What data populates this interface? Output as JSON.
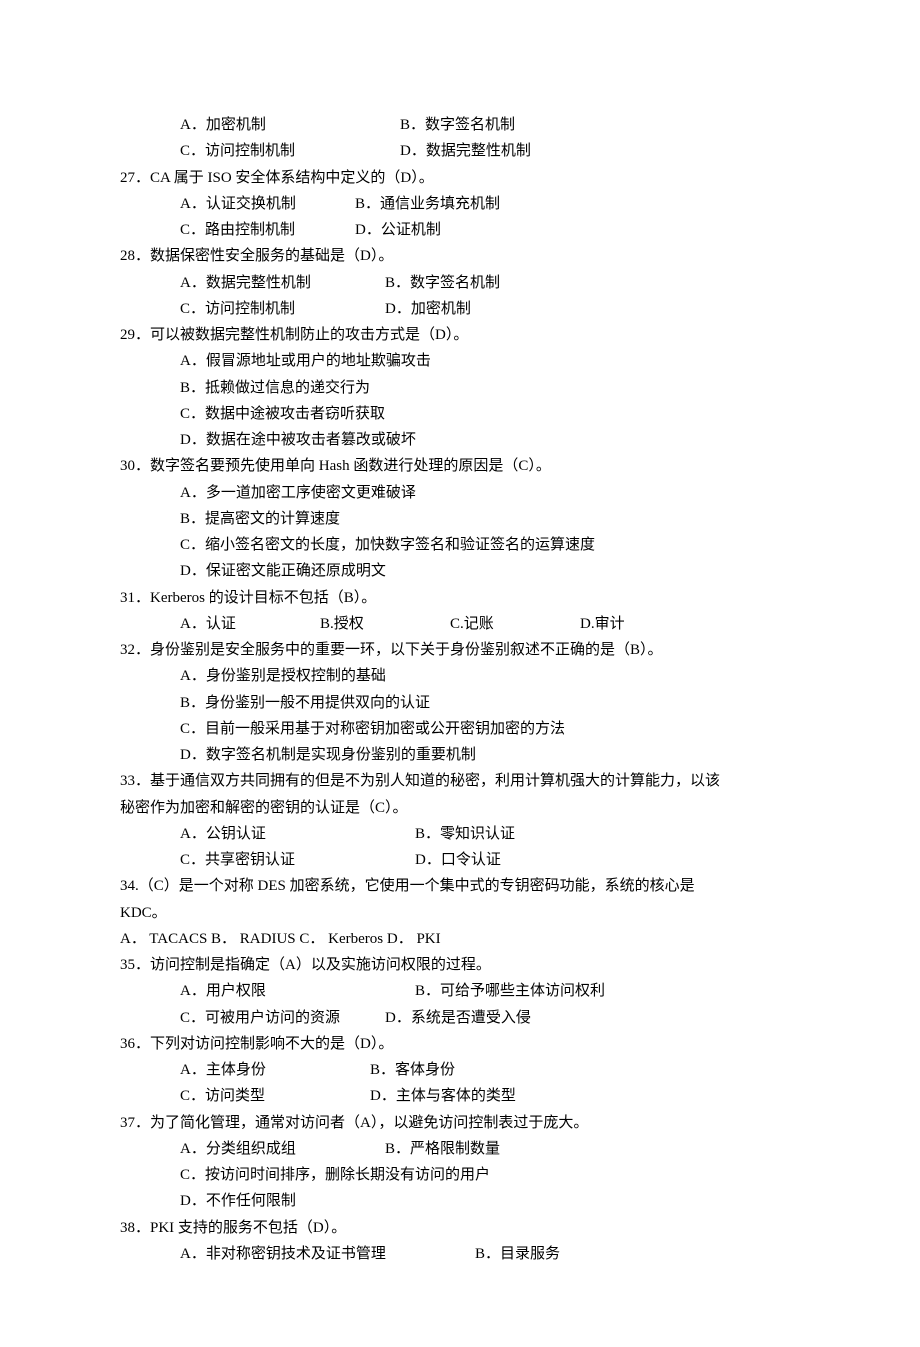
{
  "q26": {
    "opts": {
      "a": "A．加密机制",
      "b": "B．数字签名机制",
      "c": "C．访问控制机制",
      "d": "D．数据完整性机制"
    }
  },
  "q27": {
    "text": "27．CA 属于 ISO 安全体系结构中定义的（D）。",
    "opts": {
      "a": "A．认证交换机制",
      "b": "B．通信业务填充机制",
      "c": "C．路由控制机制",
      "d": "D．公证机制"
    }
  },
  "q28": {
    "text": "28．数据保密性安全服务的基础是（D）。",
    "opts": {
      "a": "A．数据完整性机制",
      "b": "B．数字签名机制",
      "c": "C．访问控制机制",
      "d": "D．加密机制"
    }
  },
  "q29": {
    "text": "29．可以被数据完整性机制防止的攻击方式是（D）。",
    "opts": {
      "a": "A．假冒源地址或用户的地址欺骗攻击",
      "b": "B．抵赖做过信息的递交行为",
      "c": "C．数据中途被攻击者窃听获取",
      "d": "D．数据在途中被攻击者篡改或破坏"
    }
  },
  "q30": {
    "text": "30．数字签名要预先使用单向 Hash 函数进行处理的原因是（C）。",
    "opts": {
      "a": "A．多一道加密工序使密文更难破译",
      "b": "B．提高密文的计算速度",
      "c": "C．缩小签名密文的长度，加快数字签名和验证签名的运算速度",
      "d": "D．保证密文能正确还原成明文"
    }
  },
  "q31": {
    "text": "31．Kerberos 的设计目标不包括（B）。",
    "opts": {
      "a": "A．认证",
      "b": "B.授权",
      "c": "C.记账",
      "d": "D.审计"
    }
  },
  "q32": {
    "text": "32．身份鉴别是安全服务中的重要一环，以下关于身份鉴别叙述不正确的是（B）。",
    "opts": {
      "a": "A．身份鉴别是授权控制的基础",
      "b": "B．身份鉴别一般不用提供双向的认证",
      "c": "C．目前一般采用基于对称密钥加密或公开密钥加密的方法",
      "d": "D．数字签名机制是实现身份鉴别的重要机制"
    }
  },
  "q33": {
    "text1": "33．基于通信双方共同拥有的但是不为别人知道的秘密，利用计算机强大的计算能力，以该",
    "text2": "秘密作为加密和解密的密钥的认证是（C）。",
    "opts": {
      "a": "A．公钥认证",
      "b": "B．零知识认证",
      "c": "C．共享密钥认证",
      "d": "D．口令认证"
    }
  },
  "q34": {
    "text1": "34.（C）是一个对称 DES 加密系统，它使用一个集中式的专钥密码功能，系统的核心是",
    "text2": "KDC。",
    "opts": "A．  TACACS    B．  RADIUS    C．  Kerberos     D．  PKI"
  },
  "q35": {
    "text": "35．访问控制是指确定（A）以及实施访问权限的过程。",
    "opts": {
      "a": "A．用户权限",
      "b": "B．可给予哪些主体访问权利",
      "c": "C．可被用户访问的资源",
      "d": "D．系统是否遭受入侵"
    }
  },
  "q36": {
    "text": "36．下列对访问控制影响不大的是（D）。",
    "opts": {
      "a": "A．主体身份",
      "b": "B．客体身份",
      "c": "C．访问类型",
      "d": "D．主体与客体的类型"
    }
  },
  "q37": {
    "text": "37．为了简化管理，通常对访问者（A），以避免访问控制表过于庞大。",
    "opts": {
      "a": "A．分类组织成组",
      "b": "B．严格限制数量",
      "c": "C．按访问时间排序，删除长期没有访问的用户",
      "d": "D．不作任何限制"
    }
  },
  "q38": {
    "text": "38．PKI 支持的服务不包括（D）。",
    "opts": {
      "a": "A．非对称密钥技术及证书管理",
      "b": "B．目录服务"
    }
  }
}
